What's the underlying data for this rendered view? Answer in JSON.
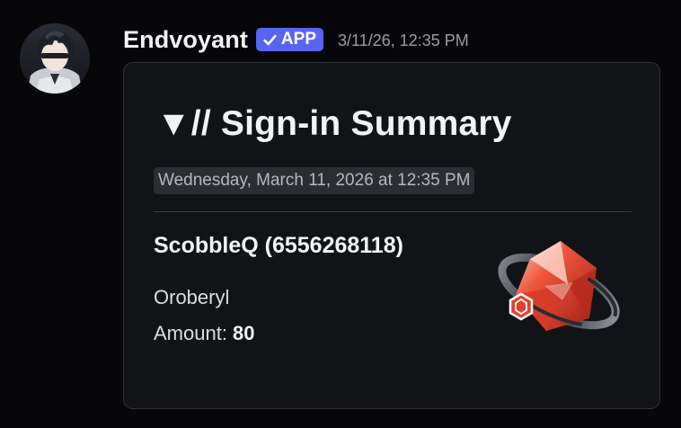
{
  "message": {
    "author": {
      "username": "Endvoyant",
      "badge_label": "APP",
      "avatar_icon": "character-portrait-avatar"
    },
    "timestamp": "3/11/26, 12:35 PM",
    "embed": {
      "title": "▼// Sign-in Summary",
      "date": "Wednesday, March 11, 2026 at 12:35 PM",
      "field": {
        "name": "ScobbleQ (6556268118)",
        "item": "Oroberyl",
        "amount_label": "Amount:",
        "amount_value": "80"
      },
      "thumbnail_icon": "oroberyl-crystal-icon"
    },
    "colors": {
      "background": "#070709",
      "embed_background": "#121316",
      "badge": "#5865f2",
      "crystal": "#e0402c"
    }
  }
}
